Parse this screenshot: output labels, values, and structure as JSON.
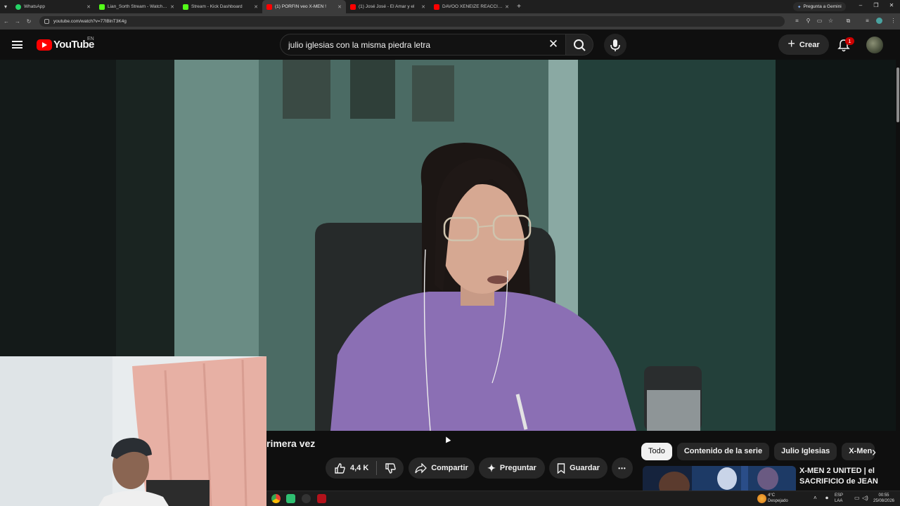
{
  "browser": {
    "tabs": [
      {
        "title": "WhatsApp",
        "fav_color": "#25d366"
      },
      {
        "title": "Lian_Sorth Stream - Watch Liv",
        "fav_color": "#53fc18"
      },
      {
        "title": "Stream - Kick Dashboard",
        "fav_color": "#53fc18"
      },
      {
        "title": "(1) PORFIN veo X-MEN !",
        "fav_color": "#ff0000"
      },
      {
        "title": "(1) José José - El Amar y el",
        "fav_color": "#ff0000"
      },
      {
        "title": "DAVOO XENEIZE REACCIONA A",
        "fav_color": "#ff0000"
      }
    ],
    "new_tab": "+",
    "gemini_label": "Pregunta a Gemini",
    "url": "youtube.com/watch?v=77lBlnT3K4g"
  },
  "youtube": {
    "logo_text": "YouTube",
    "country_code": "EN",
    "search_query": "julio iglesias con la misma piedra letra",
    "create_label": "Crear",
    "notification_count": "1"
  },
  "video": {
    "title_fragment": "rimera vez",
    "like_count": "4,4 K",
    "share_label": "Compartir",
    "ask_label": "Preguntar",
    "save_label": "Guardar",
    "more_label": "•••"
  },
  "chips": [
    "Todo",
    "Contenido de la serie",
    "Julio Iglesias",
    "X-Men"
  ],
  "recommendation": {
    "title": "X-MEN 2 UNITED | el SACRIFICIO de JEAN"
  },
  "taskbar": {
    "weather_temp": "4°C",
    "weather_desc": "Despejado",
    "lang_top": "ESP",
    "lang_bottom": "LAA",
    "time": "00:55",
    "date": "25/08/2026"
  }
}
